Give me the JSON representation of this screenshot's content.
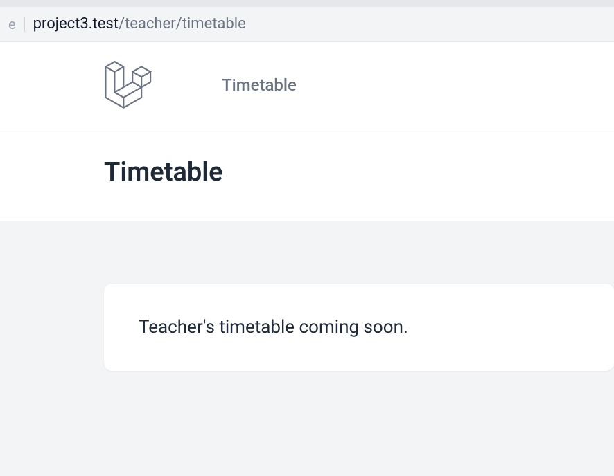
{
  "browser": {
    "url_prefix_char": "e",
    "url_domain": "project3.test",
    "url_path": "/teacher/timetable"
  },
  "nav": {
    "timetable_label": "Timetable"
  },
  "header": {
    "title": "Timetable"
  },
  "content": {
    "card_message": "Teacher's timetable coming soon."
  }
}
